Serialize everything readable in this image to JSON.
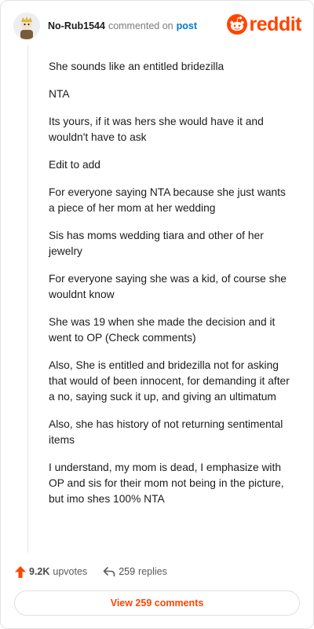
{
  "header": {
    "author": "No-Rub1544",
    "action": "commented on",
    "target": "post",
    "brand": "reddit"
  },
  "comment": {
    "paragraphs": [
      "She sounds like an entitled bridezilla",
      "NTA",
      "Its yours, if it was hers she would have it and wouldn't have to ask",
      "Edit to add",
      "For everyone saying NTA because she just wants a piece of her mom at her wedding",
      "Sis has moms wedding tiara and other of her jewelry",
      "For everyone saying she was a kid, of course she wouldnt know",
      "She was 19 when she made the decision and it went to OP (Check comments)",
      "Also, She is entitled and bridezilla not for asking that would of been innocent, for demanding it after a no, saying suck it up, and giving an ultimatum",
      "Also, she has history of not returning sentimental items",
      "I understand, my mom is dead, I emphasize with OP and sis for their mom not being in the picture, but imo shes 100% NTA"
    ]
  },
  "footer": {
    "upvotes": "9.2K",
    "upvotes_label": "upvotes",
    "replies": "259",
    "replies_label": "replies",
    "view_button": "View 259 comments"
  },
  "icons": {
    "upvote": "upvote-arrow-icon",
    "reply": "reply-arrow-icon",
    "brand": "reddit-snoo-icon",
    "avatar": "user-avatar"
  },
  "colors": {
    "brand": "#ff4500",
    "link": "#0079d3",
    "text": "#1c1c1c",
    "muted": "#7c7c7c"
  }
}
